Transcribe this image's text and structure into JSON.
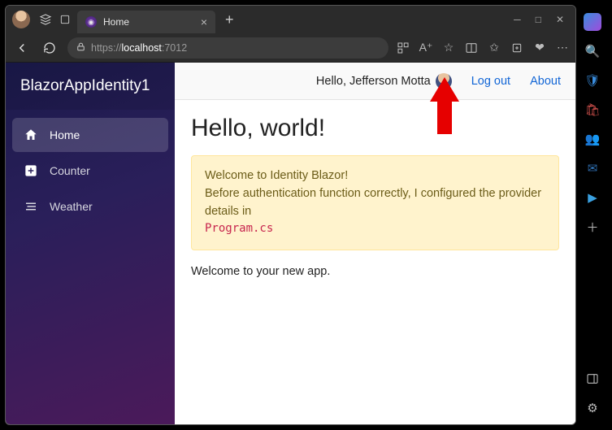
{
  "browser": {
    "tab_title": "Home",
    "url_scheme": "https://",
    "url_host": "localhost",
    "url_port": ":7012"
  },
  "sidebar": {
    "brand": "BlazorAppIdentity1",
    "items": [
      {
        "label": "Home",
        "icon": "home-icon",
        "active": true
      },
      {
        "label": "Counter",
        "icon": "plus-icon",
        "active": false
      },
      {
        "label": "Weather",
        "icon": "list-icon",
        "active": false
      }
    ]
  },
  "header": {
    "greeting": "Hello, Jefferson Motta",
    "logout": "Log out",
    "about": "About"
  },
  "page": {
    "heading": "Hello, world!",
    "alert_line1": "Welcome to Identity Blazor!",
    "alert_line2": "Before authentication function correctly, I configured the provider details in ",
    "alert_code": "Program.cs",
    "welcome": "Welcome to your new app."
  }
}
